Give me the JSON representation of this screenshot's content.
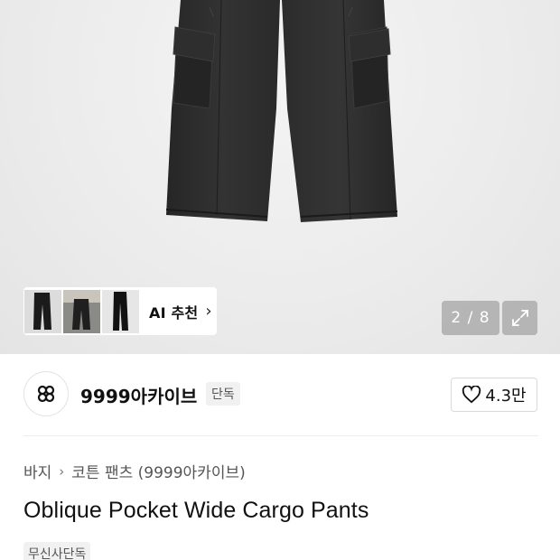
{
  "gallery": {
    "ai_recommend_label": "AI 추천",
    "counter": "2 / 8",
    "thumbnails": [
      "black-pants-thumbnail",
      "gray-pants-thumbnail",
      "black-pants-side-thumbnail"
    ]
  },
  "brand": {
    "name": "9999아카이브",
    "badge": "단독",
    "likes": "4.3만"
  },
  "breadcrumb": {
    "category": "바지",
    "subcategory": "코튼 팬츠 (9999아카이브)"
  },
  "product": {
    "title": "Oblique Pocket Wide Cargo Pants",
    "tag": "무신사단독"
  },
  "colors": {
    "pants": "#2a2a2a",
    "hero_bg": "#ececec",
    "overlay": "#969696"
  }
}
